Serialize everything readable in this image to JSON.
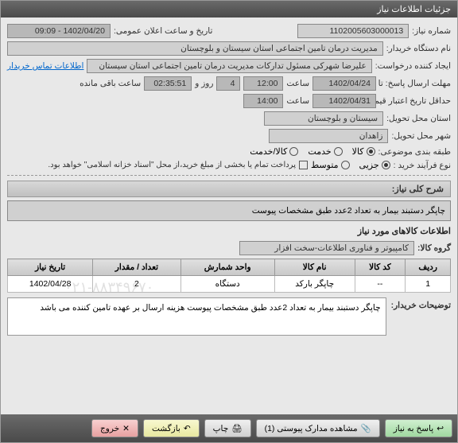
{
  "window": {
    "title": "جزئیات اطلاعات نیاز"
  },
  "fields": {
    "need_no_label": "شماره نیاز:",
    "need_no": "1102005603000013",
    "announce_label": "تاریخ و ساعت اعلان عمومی:",
    "announce_value": "1402/04/20 - 09:09",
    "buyer_org_label": "نام دستگاه خریدار:",
    "buyer_org": "مدیریت درمان تامین اجتماعی استان سیستان و بلوچستان",
    "requester_label": "ایجاد کننده درخواست:",
    "requester": "علیرضا شهرکی مسئول تدارکات مدیریت درمان تامین اجتماعی استان سیستان",
    "contact_link": "اطلاعات تماس خریدار",
    "deadline_label": "مهلت ارسال پاسخ: تا تاریخ:",
    "deadline_date": "1402/04/24",
    "time_label": "ساعت",
    "deadline_time": "12:00",
    "day_label": "روز و",
    "days_left": "4",
    "time_left": "02:35:51",
    "remaining_label": "ساعت باقی مانده",
    "validity_label": "حداقل تاریخ اعتبار قیمت: تا تاریخ:",
    "validity_date": "1402/04/31",
    "validity_time": "14:00",
    "province_label": "استان محل تحویل:",
    "province": "سیستان و بلوچستان",
    "city_label": "شهر محل تحویل:",
    "city": "زاهدان",
    "subject_cat_label": "طبقه بندی موضوعی:",
    "cat_goods": "کالا",
    "cat_service": "خدمت",
    "cat_both": "کالا/خدمت",
    "process_label": "نوع فرآیند خرید :",
    "process_partial": "جزیی",
    "process_medium": "متوسط",
    "payment_note": "پرداخت تمام یا بخشی از مبلغ خرید،از محل \"اسناد خزانه اسلامی\" خواهد بود."
  },
  "description": {
    "header": "شرح کلی نیاز:",
    "text": "چاپگر دستبند بیمار به تعداد 2عدد طبق مشخصات پیوست"
  },
  "goods_info": {
    "title": "اطلاعات کالاهای مورد نیاز",
    "group_label": "گروه کالا:",
    "group_value": "کامپیوتر و فناوری اطلاعات-سخت افزار"
  },
  "table": {
    "headers": {
      "row": "ردیف",
      "code": "کد کالا",
      "name": "نام کالا",
      "unit": "واحد شمارش",
      "qty": "تعداد / مقدار",
      "date": "تاریخ نیاز"
    },
    "rows": [
      {
        "row": "1",
        "code": "--",
        "name": "چاپگر بارکد",
        "unit": "دستگاه",
        "qty": "2",
        "date": "1402/04/28"
      }
    ]
  },
  "buyer_note": {
    "label": "توضیحات خریدار:",
    "text": "چاپگر دستبند بیمار به تعداد 2عدد طبق مشخصات پیوست هزینه ارسال بر عهده تامین کننده می باشد"
  },
  "buttons": {
    "respond": "پاسخ به نیاز",
    "attachments": "مشاهده مدارک پیوستی (1)",
    "print": "چاپ",
    "back": "بازگشت",
    "exit": "خروج"
  },
  "watermark": "۰۲۱-۸۸۳۴۹۶۷۰"
}
